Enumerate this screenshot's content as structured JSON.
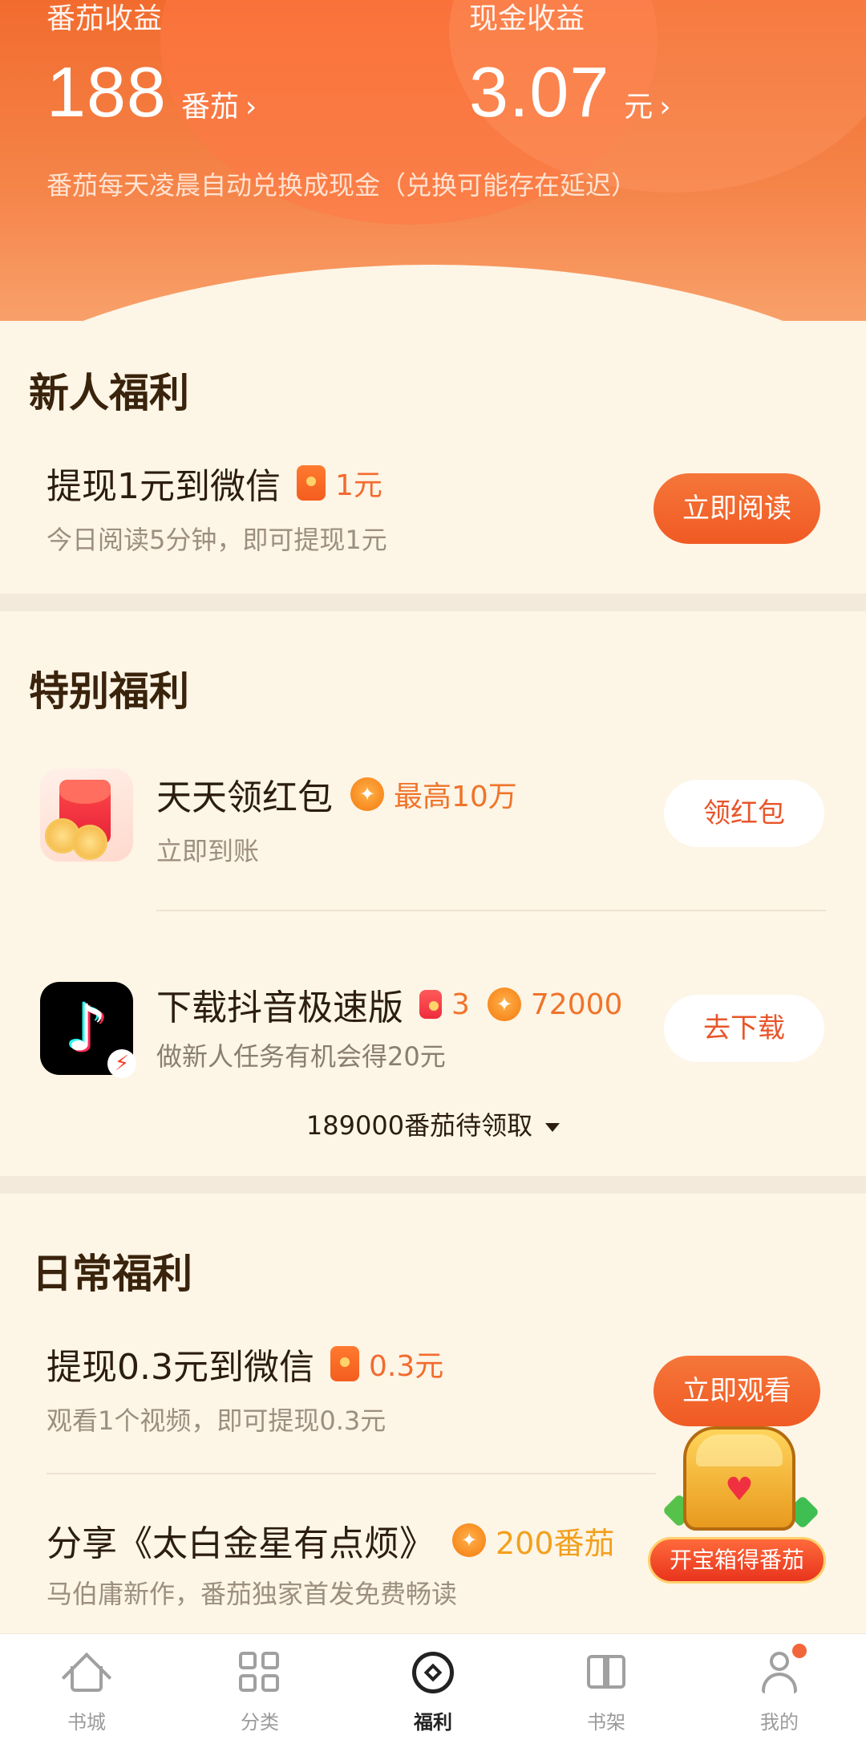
{
  "earnings": {
    "tomato": {
      "label": "番茄收益",
      "amount": "188",
      "unit": "番茄",
      "chevron": "›"
    },
    "cash": {
      "label": "现金收益",
      "amount": "3.07",
      "unit": "元",
      "chevron": "›"
    },
    "note": "番茄每天凌晨自动兑换成现金（兑换可能存在延迟）"
  },
  "newcomer": {
    "title": "新人福利",
    "task": {
      "title": "提现1元到微信",
      "reward": "1元",
      "subtitle": "今日阅读5分钟，即可提现1元",
      "button": "立即阅读"
    }
  },
  "special": {
    "title": "特别福利",
    "items": [
      {
        "title": "天天领红包",
        "reward_icon": "coin-icon",
        "reward": "最高10万",
        "subtitle": "立即到账",
        "button": "领红包"
      },
      {
        "title": "下载抖音极速版",
        "redpacket_count": "3",
        "reward": "72000",
        "subtitle": "做新人任务有机会得20元",
        "button": "去下载"
      }
    ],
    "collapse": "189000番茄待领取"
  },
  "daily": {
    "title": "日常福利",
    "items": [
      {
        "title": "提现0.3元到微信",
        "reward": "0.3元",
        "subtitle": "观看1个视频，即可提现0.3元",
        "button": "立即观看"
      },
      {
        "title": "分享《太白金星有点烦》",
        "reward": "200番茄",
        "subtitle": "马伯庸新作，番茄独家首发免费畅读"
      }
    ]
  },
  "treasure": {
    "label": "开宝箱得番茄"
  },
  "tabbar": {
    "tabs": [
      {
        "label": "书城",
        "icon": "house-icon"
      },
      {
        "label": "分类",
        "icon": "grid-icon"
      },
      {
        "label": "福利",
        "icon": "welfare-icon",
        "active": true
      },
      {
        "label": "书架",
        "icon": "book-icon"
      },
      {
        "label": "我的",
        "icon": "user-icon"
      }
    ]
  },
  "colors": {
    "accent": "#f26b2e",
    "background": "#fdf5e6",
    "gold": "#f2a01e"
  }
}
